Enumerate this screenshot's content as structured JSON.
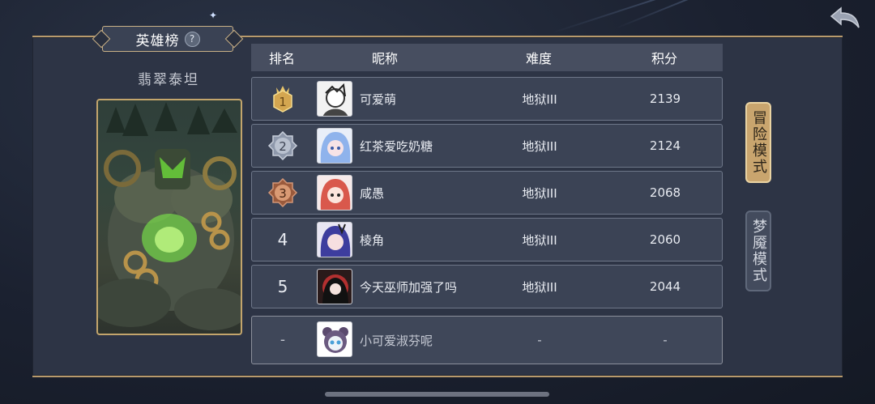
{
  "header": {
    "title": "英雄榜",
    "help": "?"
  },
  "hero": {
    "name": "翡翠泰坦"
  },
  "table": {
    "columns": {
      "rank": "排名",
      "nickname": "昵称",
      "difficulty": "难度",
      "score": "积分"
    },
    "rows": [
      {
        "rank": "1",
        "nickname": "可爱萌",
        "difficulty": "地狱III",
        "score": "2139"
      },
      {
        "rank": "2",
        "nickname": "红茶爱吃奶糖",
        "difficulty": "地狱III",
        "score": "2124"
      },
      {
        "rank": "3",
        "nickname": "咸愚",
        "difficulty": "地狱III",
        "score": "2068"
      },
      {
        "rank": "4",
        "nickname": "棱角",
        "difficulty": "地狱III",
        "score": "2060"
      },
      {
        "rank": "5",
        "nickname": "今天巫师加强了吗",
        "difficulty": "地狱III",
        "score": "2044"
      }
    ],
    "self": {
      "rank": "-",
      "nickname": "小可爱淑芬呢",
      "difficulty": "-",
      "score": "-"
    }
  },
  "modes": {
    "adventure": "冒险模式",
    "nightmare": "梦魇模式"
  },
  "colors": {
    "gold": "#c9a56e",
    "silver": "#9aa4b5",
    "bronze": "#b87452",
    "panel": "#2d3445"
  }
}
